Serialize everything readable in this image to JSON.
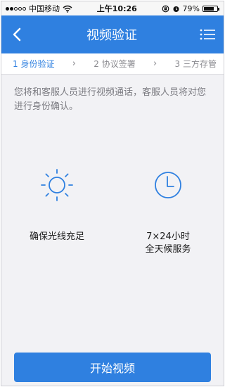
{
  "status_bar": {
    "carrier": "中国移动",
    "time": "上午10:26",
    "battery": "79%",
    "battery_level": 0.79,
    "signal_bars_filled": 2,
    "signal_bars_total": 5
  },
  "nav": {
    "title": "视频验证",
    "back_icon": "chevron-left-icon",
    "menu_icon": "list-menu-icon"
  },
  "steps": [
    {
      "label": "1 身份验证",
      "active": true
    },
    {
      "label": "2 协议签署",
      "active": false
    },
    {
      "label": "3 三方存管",
      "active": false
    }
  ],
  "intro": "您将和客服人员进行视频通话，客服人员将对您进行身份确认。",
  "features": [
    {
      "icon": "sun-icon",
      "line1": "确保光线充足",
      "line2": ""
    },
    {
      "icon": "clock-icon",
      "line1": "7×24小时",
      "line2": "全天候服务"
    }
  ],
  "cta": {
    "label": "开始视频"
  },
  "colors": {
    "brand": "#2f80e0",
    "background": "#f2f2f5",
    "muted_text": "#7c7c82"
  }
}
